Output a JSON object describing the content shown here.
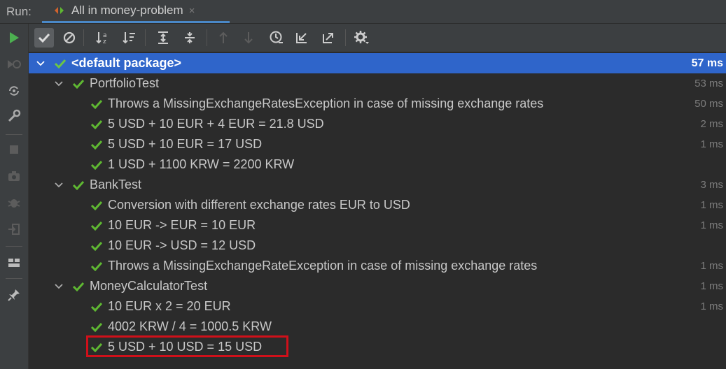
{
  "run_bar": {
    "label": "Run:",
    "tab_title": "All in money-problem",
    "tab_close": "×"
  },
  "colors": {
    "accent_blue": "#2f65ca",
    "pass_green": "#5fb832",
    "highlight_red": "#d0101a",
    "run_green": "#4caf50"
  },
  "toolbar_icons": [
    "show-passed-icon",
    "show-ignored-icon",
    "sort-alphabetically-icon",
    "sort-by-duration-icon",
    "expand-all-icon",
    "collapse-all-icon",
    "previous-failed-icon",
    "next-failed-icon",
    "test-history-icon",
    "import-tests-icon",
    "export-results-icon",
    "settings-icon"
  ],
  "left_icons": [
    "run-icon",
    "rerun-failed-icon",
    "toggle-auto-test-icon",
    "wrench-icon",
    "stop-icon",
    "camera-icon",
    "debug-icon",
    "exit-icon",
    "layout-icon",
    "pin-icon"
  ],
  "tree": {
    "root": {
      "label": "<default package>",
      "duration": "57 ms"
    },
    "groups": [
      {
        "label": "PortfolioTest",
        "duration": "53 ms",
        "tests": [
          {
            "label": "Throws a MissingExchangeRatesException in case of missing exchange rates",
            "duration": "50 ms"
          },
          {
            "label": "5 USD + 10 EUR + 4 EUR = 21.8 USD",
            "duration": "2 ms"
          },
          {
            "label": "5 USD + 10 EUR = 17 USD",
            "duration": "1 ms"
          },
          {
            "label": "1 USD + 1100 KRW = 2200 KRW",
            "duration": ""
          }
        ]
      },
      {
        "label": "BankTest",
        "duration": "3 ms",
        "tests": [
          {
            "label": "Conversion with different exchange rates EUR to USD",
            "duration": "1 ms"
          },
          {
            "label": "10 EUR -> EUR = 10 EUR",
            "duration": "1 ms"
          },
          {
            "label": "10 EUR -> USD = 12 USD",
            "duration": ""
          },
          {
            "label": "Throws a MissingExchangeRateException in case of missing exchange rates",
            "duration": "1 ms"
          }
        ]
      },
      {
        "label": "MoneyCalculatorTest",
        "duration": "1 ms",
        "tests": [
          {
            "label": "10 EUR x 2 = 20 EUR",
            "duration": "1 ms"
          },
          {
            "label": "4002 KRW / 4 = 1000.5 KRW",
            "duration": ""
          },
          {
            "label": "5 USD + 10 USD = 15 USD",
            "duration": ""
          }
        ]
      }
    ]
  }
}
